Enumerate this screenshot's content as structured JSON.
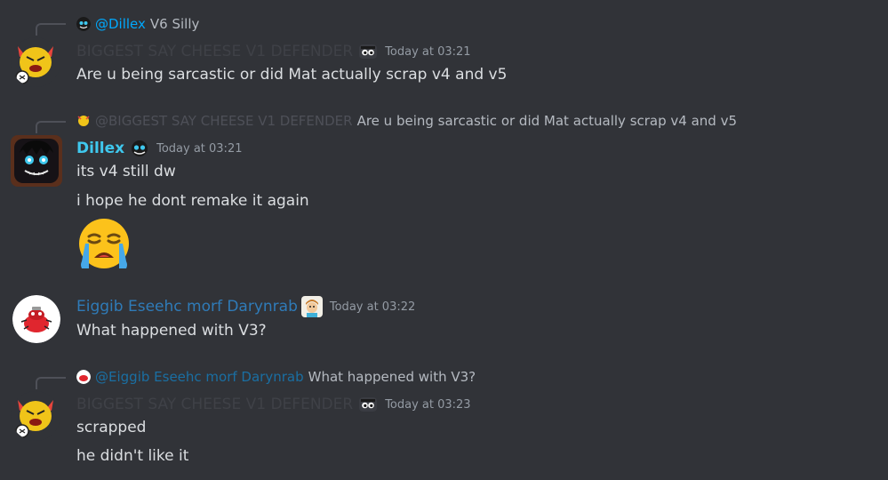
{
  "messages": [
    {
      "reply": {
        "mention": "@Dillex",
        "text": "V6 Silly"
      },
      "author": "BIGGEST SAY CHEESE V1 DEFENDER",
      "timestamp": "Today at 03:21",
      "lines": [
        "Are u being sarcastic or did Mat actually scrap v4 and v5"
      ]
    },
    {
      "reply": {
        "mention": "@BIGGEST SAY CHEESE V1 DEFENDER",
        "text": "Are u being sarcastic or did Mat actually scrap v4 and v5"
      },
      "author": "Dillex",
      "timestamp": "Today at 03:21",
      "lines": [
        "its v4 still dw",
        "i hope he dont remake it again"
      ],
      "emoji": "😭"
    },
    {
      "author": "Eiggib Eseehc morf Darynrab",
      "timestamp": "Today at 03:22",
      "lines": [
        "What happened with V3?"
      ]
    },
    {
      "reply": {
        "mention": "@Eiggib Eseehc morf Darynrab",
        "text": "What happened with V3?"
      },
      "author": "BIGGEST SAY CHEESE V1 DEFENDER",
      "timestamp": "Today at 03:23",
      "lines": [
        "scrapped",
        "he didn't like it"
      ]
    }
  ],
  "colors": {
    "background": "#313338",
    "text": "#dbdee1",
    "mention": "#00a8fc",
    "dillex_name": "#3fc8ee",
    "eiggib_name": "#2f7bb8",
    "muted_name": "#3f4147",
    "timestamp": "#949ba4"
  }
}
